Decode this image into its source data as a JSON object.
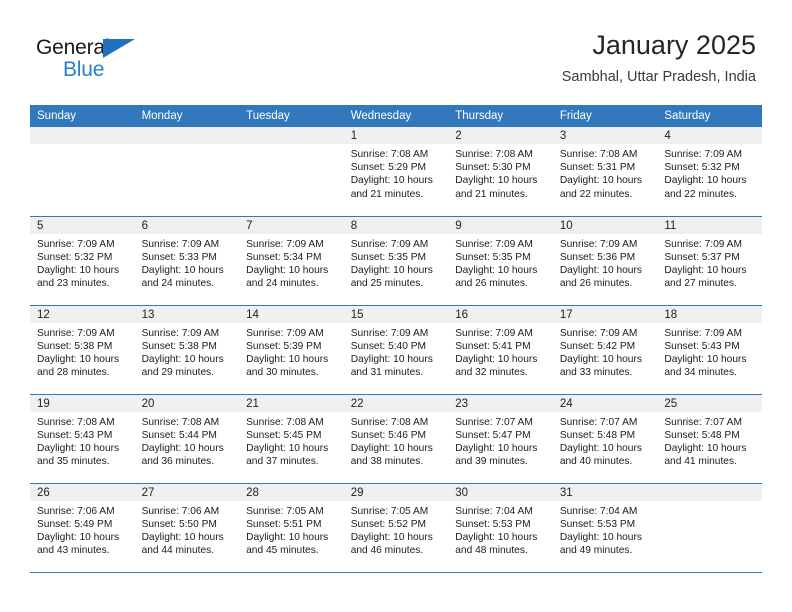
{
  "brand": {
    "name_part1": "General",
    "name_part2": "Blue",
    "triangle_color": "#1f72bd",
    "blue_color": "#2a7fc9"
  },
  "header": {
    "title": "January 2025",
    "subtitle": "Sambhal, Uttar Pradesh, India"
  },
  "theme": {
    "header_blue": "#3179bc",
    "daynum_band": "#f0f0f0",
    "text": "#1c1c1c"
  },
  "weekdays": [
    "Sunday",
    "Monday",
    "Tuesday",
    "Wednesday",
    "Thursday",
    "Friday",
    "Saturday"
  ],
  "weeks": [
    [
      {
        "day": "",
        "sunrise": "",
        "sunset": "",
        "daylight_line1": "",
        "daylight_line2": "",
        "empty": true
      },
      {
        "day": "",
        "sunrise": "",
        "sunset": "",
        "daylight_line1": "",
        "daylight_line2": "",
        "empty": true
      },
      {
        "day": "",
        "sunrise": "",
        "sunset": "",
        "daylight_line1": "",
        "daylight_line2": "",
        "empty": true
      },
      {
        "day": "1",
        "sunrise": "Sunrise: 7:08 AM",
        "sunset": "Sunset: 5:29 PM",
        "daylight_line1": "Daylight: 10 hours",
        "daylight_line2": "and 21 minutes."
      },
      {
        "day": "2",
        "sunrise": "Sunrise: 7:08 AM",
        "sunset": "Sunset: 5:30 PM",
        "daylight_line1": "Daylight: 10 hours",
        "daylight_line2": "and 21 minutes."
      },
      {
        "day": "3",
        "sunrise": "Sunrise: 7:08 AM",
        "sunset": "Sunset: 5:31 PM",
        "daylight_line1": "Daylight: 10 hours",
        "daylight_line2": "and 22 minutes."
      },
      {
        "day": "4",
        "sunrise": "Sunrise: 7:09 AM",
        "sunset": "Sunset: 5:32 PM",
        "daylight_line1": "Daylight: 10 hours",
        "daylight_line2": "and 22 minutes."
      }
    ],
    [
      {
        "day": "5",
        "sunrise": "Sunrise: 7:09 AM",
        "sunset": "Sunset: 5:32 PM",
        "daylight_line1": "Daylight: 10 hours",
        "daylight_line2": "and 23 minutes."
      },
      {
        "day": "6",
        "sunrise": "Sunrise: 7:09 AM",
        "sunset": "Sunset: 5:33 PM",
        "daylight_line1": "Daylight: 10 hours",
        "daylight_line2": "and 24 minutes."
      },
      {
        "day": "7",
        "sunrise": "Sunrise: 7:09 AM",
        "sunset": "Sunset: 5:34 PM",
        "daylight_line1": "Daylight: 10 hours",
        "daylight_line2": "and 24 minutes."
      },
      {
        "day": "8",
        "sunrise": "Sunrise: 7:09 AM",
        "sunset": "Sunset: 5:35 PM",
        "daylight_line1": "Daylight: 10 hours",
        "daylight_line2": "and 25 minutes."
      },
      {
        "day": "9",
        "sunrise": "Sunrise: 7:09 AM",
        "sunset": "Sunset: 5:35 PM",
        "daylight_line1": "Daylight: 10 hours",
        "daylight_line2": "and 26 minutes."
      },
      {
        "day": "10",
        "sunrise": "Sunrise: 7:09 AM",
        "sunset": "Sunset: 5:36 PM",
        "daylight_line1": "Daylight: 10 hours",
        "daylight_line2": "and 26 minutes."
      },
      {
        "day": "11",
        "sunrise": "Sunrise: 7:09 AM",
        "sunset": "Sunset: 5:37 PM",
        "daylight_line1": "Daylight: 10 hours",
        "daylight_line2": "and 27 minutes."
      }
    ],
    [
      {
        "day": "12",
        "sunrise": "Sunrise: 7:09 AM",
        "sunset": "Sunset: 5:38 PM",
        "daylight_line1": "Daylight: 10 hours",
        "daylight_line2": "and 28 minutes."
      },
      {
        "day": "13",
        "sunrise": "Sunrise: 7:09 AM",
        "sunset": "Sunset: 5:38 PM",
        "daylight_line1": "Daylight: 10 hours",
        "daylight_line2": "and 29 minutes."
      },
      {
        "day": "14",
        "sunrise": "Sunrise: 7:09 AM",
        "sunset": "Sunset: 5:39 PM",
        "daylight_line1": "Daylight: 10 hours",
        "daylight_line2": "and 30 minutes."
      },
      {
        "day": "15",
        "sunrise": "Sunrise: 7:09 AM",
        "sunset": "Sunset: 5:40 PM",
        "daylight_line1": "Daylight: 10 hours",
        "daylight_line2": "and 31 minutes."
      },
      {
        "day": "16",
        "sunrise": "Sunrise: 7:09 AM",
        "sunset": "Sunset: 5:41 PM",
        "daylight_line1": "Daylight: 10 hours",
        "daylight_line2": "and 32 minutes."
      },
      {
        "day": "17",
        "sunrise": "Sunrise: 7:09 AM",
        "sunset": "Sunset: 5:42 PM",
        "daylight_line1": "Daylight: 10 hours",
        "daylight_line2": "and 33 minutes."
      },
      {
        "day": "18",
        "sunrise": "Sunrise: 7:09 AM",
        "sunset": "Sunset: 5:43 PM",
        "daylight_line1": "Daylight: 10 hours",
        "daylight_line2": "and 34 minutes."
      }
    ],
    [
      {
        "day": "19",
        "sunrise": "Sunrise: 7:08 AM",
        "sunset": "Sunset: 5:43 PM",
        "daylight_line1": "Daylight: 10 hours",
        "daylight_line2": "and 35 minutes."
      },
      {
        "day": "20",
        "sunrise": "Sunrise: 7:08 AM",
        "sunset": "Sunset: 5:44 PM",
        "daylight_line1": "Daylight: 10 hours",
        "daylight_line2": "and 36 minutes."
      },
      {
        "day": "21",
        "sunrise": "Sunrise: 7:08 AM",
        "sunset": "Sunset: 5:45 PM",
        "daylight_line1": "Daylight: 10 hours",
        "daylight_line2": "and 37 minutes."
      },
      {
        "day": "22",
        "sunrise": "Sunrise: 7:08 AM",
        "sunset": "Sunset: 5:46 PM",
        "daylight_line1": "Daylight: 10 hours",
        "daylight_line2": "and 38 minutes."
      },
      {
        "day": "23",
        "sunrise": "Sunrise: 7:07 AM",
        "sunset": "Sunset: 5:47 PM",
        "daylight_line1": "Daylight: 10 hours",
        "daylight_line2": "and 39 minutes."
      },
      {
        "day": "24",
        "sunrise": "Sunrise: 7:07 AM",
        "sunset": "Sunset: 5:48 PM",
        "daylight_line1": "Daylight: 10 hours",
        "daylight_line2": "and 40 minutes."
      },
      {
        "day": "25",
        "sunrise": "Sunrise: 7:07 AM",
        "sunset": "Sunset: 5:48 PM",
        "daylight_line1": "Daylight: 10 hours",
        "daylight_line2": "and 41 minutes."
      }
    ],
    [
      {
        "day": "26",
        "sunrise": "Sunrise: 7:06 AM",
        "sunset": "Sunset: 5:49 PM",
        "daylight_line1": "Daylight: 10 hours",
        "daylight_line2": "and 43 minutes."
      },
      {
        "day": "27",
        "sunrise": "Sunrise: 7:06 AM",
        "sunset": "Sunset: 5:50 PM",
        "daylight_line1": "Daylight: 10 hours",
        "daylight_line2": "and 44 minutes."
      },
      {
        "day": "28",
        "sunrise": "Sunrise: 7:05 AM",
        "sunset": "Sunset: 5:51 PM",
        "daylight_line1": "Daylight: 10 hours",
        "daylight_line2": "and 45 minutes."
      },
      {
        "day": "29",
        "sunrise": "Sunrise: 7:05 AM",
        "sunset": "Sunset: 5:52 PM",
        "daylight_line1": "Daylight: 10 hours",
        "daylight_line2": "and 46 minutes."
      },
      {
        "day": "30",
        "sunrise": "Sunrise: 7:04 AM",
        "sunset": "Sunset: 5:53 PM",
        "daylight_line1": "Daylight: 10 hours",
        "daylight_line2": "and 48 minutes."
      },
      {
        "day": "31",
        "sunrise": "Sunrise: 7:04 AM",
        "sunset": "Sunset: 5:53 PM",
        "daylight_line1": "Daylight: 10 hours",
        "daylight_line2": "and 49 minutes."
      },
      {
        "day": "",
        "sunrise": "",
        "sunset": "",
        "daylight_line1": "",
        "daylight_line2": "",
        "empty": true
      }
    ]
  ]
}
